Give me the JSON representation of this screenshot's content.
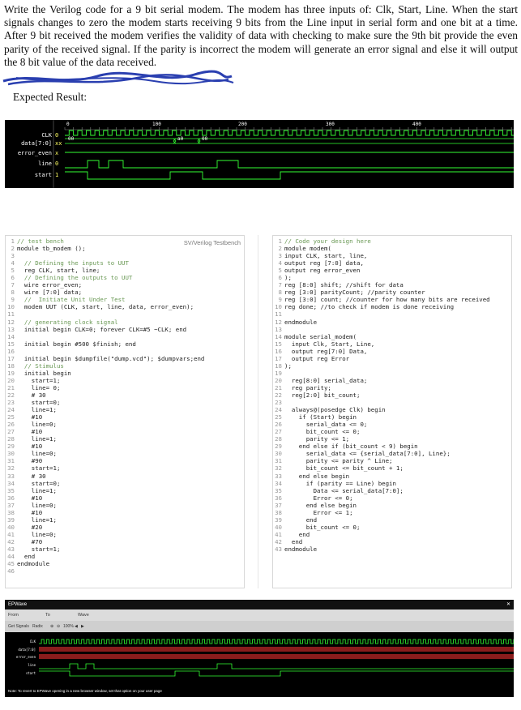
{
  "prompt": {
    "paragraph": "Write the Verilog code for a 9 bit serial modem. The modem has three inputs of: Clk, Start, Line. When the start signals changes to zero the modem starts receiving 9 bits from the Line input in serial form and one bit at a time. After 9 bit received the modem verifies the validity of data with checking to make sure the 9th bit provide the even parity of the received signal. If the parity is incorrect the modem will generate an error signal and else it will output the 8 bit value of the data received.",
    "expected_label": "Expected Result:"
  },
  "waveform": {
    "time_markers": [
      "0",
      "100",
      "200",
      "300",
      "400"
    ],
    "signals": [
      {
        "name": "CLK",
        "value": "0"
      },
      {
        "name": "data[7:0]",
        "value": "xx"
      },
      {
        "name": "error_even",
        "value": "x"
      },
      {
        "name": "line",
        "value": "0"
      },
      {
        "name": "start",
        "value": "1"
      }
    ],
    "bus_values": [
      "00",
      "a0",
      "00"
    ]
  },
  "testbench": {
    "title": "SV/Verilog Testbench",
    "lines": [
      "// test bench",
      "module tb_modem ();",
      "",
      "  // Defining the inputs to UUT",
      "  reg CLK, start, line;",
      "  // Defining the outputs to UUT",
      "  wire error_even;",
      "  wire [7:0] data;",
      "  //  Initiate Unit Under Test",
      "  modem UUT (CLK, start, line, data, error_even);",
      "",
      "  // generating clock signal",
      "  initial begin CLK=0; forever CLK=#5 ~CLK; end",
      "",
      "  initial begin #500 $finish; end",
      "",
      "  initial begin $dumpfile(\"dump.vcd\"); $dumpvars;end",
      "  // Stimulus",
      "  initial begin",
      "    start=1;",
      "    line= 0;",
      "    # 30",
      "    start=0;",
      "    line=1;",
      "    #10",
      "    line=0;",
      "    #10",
      "    line=1;",
      "    #10",
      "    line=0;",
      "    #90",
      "    start=1;",
      "    # 30",
      "    start=0;",
      "    line=1;",
      "    #10",
      "    line=0;",
      "    #10",
      "    line=1;",
      "    #20",
      "    line=0;",
      "    #70",
      "    start=1;",
      "  end",
      "endmodule",
      ""
    ]
  },
  "design": {
    "lines": [
      "// Code your design here",
      "module modem(",
      "input CLK, start, line,",
      "output reg [7:0] data,",
      "output reg error_even",
      ");",
      "reg [8:0] shift; //shift for data",
      "reg [3:0] parityCount; //parity counter",
      "reg [3:0] count; //counter for how many bits are received",
      "reg done; //to check if modem is done receiving",
      "",
      "endmodule",
      "",
      "module serial_modem(",
      "  input Clk, Start, Line,",
      "  output reg[7:0] Data,",
      "  output reg Error",
      ");",
      "",
      "  reg[8:0] serial_data;",
      "  reg parity;",
      "  reg[2:0] bit_count;",
      "",
      "  always@(posedge Clk) begin",
      "    if (Start) begin",
      "      serial_data <= 0;",
      "      bit_count <= 0;",
      "      parity <= 1;",
      "    end else if (bit_count < 9) begin",
      "      serial_data <= {serial_data[7:0], Line};",
      "      parity <= parity ^ Line;",
      "      bit_count <= bit_count + 1;",
      "    end else begin",
      "      if (parity == Line) begin",
      "        Data <= serial_data[7:0];",
      "        Error <= 0;",
      "      end else begin",
      "        Error <= 1;",
      "      end",
      "      bit_count <= 0;",
      "    end",
      "  end",
      "endmodule"
    ]
  },
  "epwave": {
    "title": "EPWave",
    "menu": [
      "From",
      "To",
      "Wave"
    ],
    "toolbar": [
      "Get Signals",
      "Radix",
      "100%"
    ],
    "signals": [
      "CLK",
      "data[7:0]",
      "error_even",
      "line",
      "start"
    ],
    "note": "Note: To revert to EPWave opening in a new browser window, set that option on your user page"
  }
}
